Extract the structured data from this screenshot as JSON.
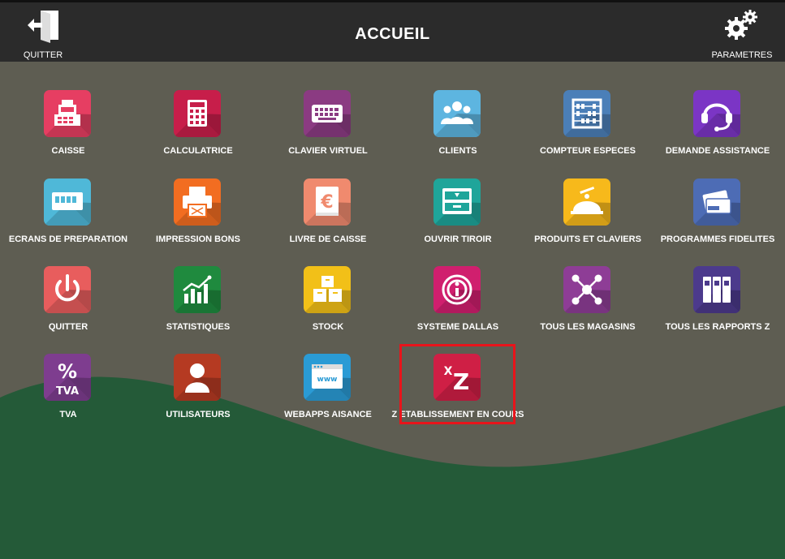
{
  "header": {
    "title": "ACCUEIL",
    "quit_label": "QUITTER",
    "settings_label": "PARAMETRES"
  },
  "tiles": [
    {
      "label": "CAISSE",
      "color": "#e63e62",
      "icon": "cash-register-icon"
    },
    {
      "label": "CALCULATRICE",
      "color": "#c71e4a",
      "icon": "calculator-icon"
    },
    {
      "label": "CLAVIER VIRTUEL",
      "color": "#8b3b82",
      "icon": "keyboard-icon"
    },
    {
      "label": "CLIENTS",
      "color": "#5db5e0",
      "icon": "users-icon"
    },
    {
      "label": "COMPTEUR ESPECES",
      "color": "#4b7fb8",
      "icon": "abacus-icon"
    },
    {
      "label": "DEMANDE ASSISTANCE",
      "color": "#7b35c5",
      "icon": "headset-icon"
    },
    {
      "label": "ECRANS DE PREPARATION",
      "color": "#4fb8d8",
      "icon": "display-icon"
    },
    {
      "label": "IMPRESSION BONS",
      "color": "#f26d21",
      "icon": "printer-icon"
    },
    {
      "label": "LIVRE DE CAISSE",
      "color": "#f08a6e",
      "icon": "euro-book-icon"
    },
    {
      "label": "OUVRIR TIROIR",
      "color": "#1fa59a",
      "icon": "drawer-icon"
    },
    {
      "label": "PRODUITS ET CLAVIERS",
      "color": "#f7b91b",
      "icon": "cloche-icon"
    },
    {
      "label": "PROGRAMMES FIDELITES",
      "color": "#4d6cb5",
      "icon": "loyalty-card-icon"
    },
    {
      "label": "QUITTER",
      "color": "#e85d5d",
      "icon": "power-icon"
    },
    {
      "label": "STATISTIQUES",
      "color": "#1f8a3e",
      "icon": "bar-chart-icon"
    },
    {
      "label": "STOCK",
      "color": "#f2c018",
      "icon": "boxes-icon"
    },
    {
      "label": "SYSTEME DALLAS",
      "color": "#d01f6e",
      "icon": "dallas-key-icon"
    },
    {
      "label": "TOUS LES MAGASINS",
      "color": "#8e3d96",
      "icon": "network-icon"
    },
    {
      "label": "TOUS LES RAPPORTS Z",
      "color": "#4c3a8c",
      "icon": "binders-icon"
    },
    {
      "label": "TVA",
      "color": "#7e3d8f",
      "icon": "percent-icon"
    },
    {
      "label": "UTILISATEURS",
      "color": "#b53a22",
      "icon": "user-icon"
    },
    {
      "label": "WEBAPPS AISANCE",
      "color": "#2a9bd5",
      "icon": "browser-icon"
    },
    {
      "label": "Z ETABLISSEMENT EN COURS",
      "color": "#cf1f45",
      "icon": "z-report-icon"
    }
  ]
}
